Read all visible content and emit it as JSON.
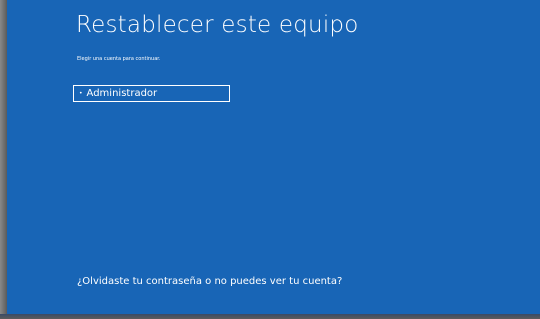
{
  "screen": {
    "title": "Restablecer este equipo",
    "subtitle": "Elegir una cuenta para continuar.",
    "accounts": [
      {
        "bullet": "•",
        "label": "Administrador"
      }
    ],
    "forgot_link": "¿Olvidaste tu contraseña o no puedes ver tu cuenta?"
  },
  "colors": {
    "background": "#1865b6",
    "text": "#ffffff"
  }
}
